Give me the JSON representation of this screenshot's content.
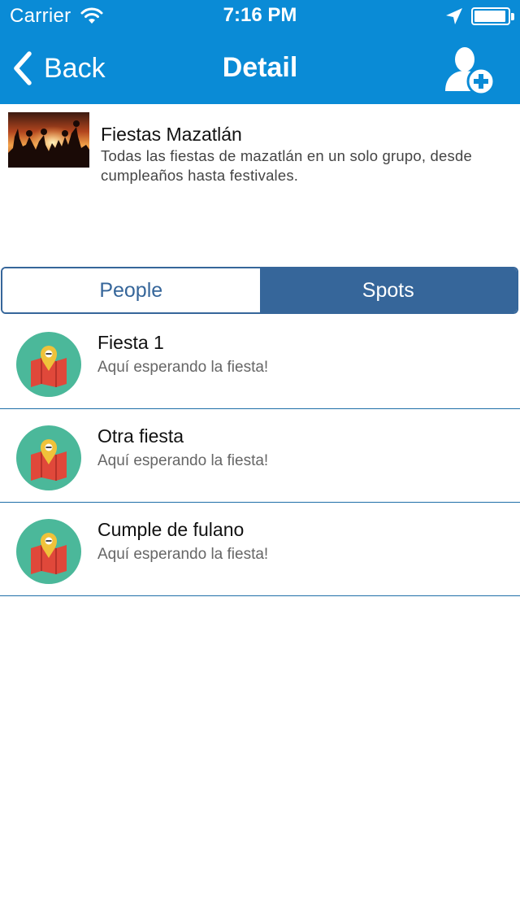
{
  "status_bar": {
    "carrier": "Carrier",
    "time": "7:16 PM"
  },
  "nav": {
    "back_label": "Back",
    "title": "Detail",
    "add_icon": "add-user-icon"
  },
  "group": {
    "name": "Fiestas Mazatlán",
    "description": "Todas las fiestas de mazatlán en un solo grupo, desde cumpleaños hasta festivales."
  },
  "tabs": [
    {
      "label": "People",
      "selected": false
    },
    {
      "label": "Spots",
      "selected": true
    }
  ],
  "spots": [
    {
      "title": "Fiesta 1",
      "subtitle": "Aquí esperando la fiesta!"
    },
    {
      "title": "Otra fiesta",
      "subtitle": "Aquí esperando la fiesta!"
    },
    {
      "title": "Cumple de fulano",
      "subtitle": "Aquí esperando la fiesta!"
    }
  ],
  "colors": {
    "nav_bar": "#0a8bd6",
    "segment": "#36669a",
    "avatar_bg": "#4bb89a",
    "map": "#e0483a",
    "pin": "#f0c23a"
  }
}
